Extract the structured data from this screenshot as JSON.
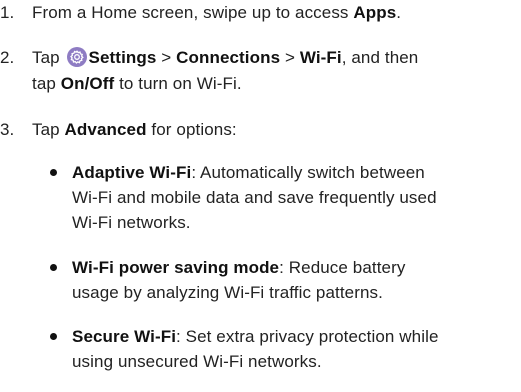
{
  "steps": [
    {
      "number": "1.",
      "segments": [
        {
          "text": "From a Home screen, swipe up to access "
        },
        {
          "text": "Apps",
          "bold": true
        },
        {
          "text": "."
        }
      ]
    },
    {
      "number": "2.",
      "line1": [
        {
          "text": "Tap "
        },
        {
          "text": "Settings",
          "bold": true
        },
        {
          "text": " > "
        },
        {
          "text": "Connections",
          "bold": true
        },
        {
          "text": " > "
        },
        {
          "text": "Wi-Fi",
          "bold": true
        },
        {
          "text": ", and then"
        }
      ],
      "line2": [
        {
          "text": "tap "
        },
        {
          "text": "On/Off",
          "bold": true
        },
        {
          "text": " to turn on Wi-Fi."
        }
      ],
      "icon": "settings-gear-icon"
    },
    {
      "number": "3.",
      "segments": [
        {
          "text": "Tap "
        },
        {
          "text": "Advanced",
          "bold": true
        },
        {
          "text": " for options:"
        }
      ]
    }
  ],
  "options": [
    {
      "name": "Adaptive Wi-Fi",
      "lines": [
        ": Automatically switch between",
        "Wi-Fi and mobile data and save frequently used",
        "Wi-Fi networks."
      ]
    },
    {
      "name": "Wi-Fi power saving mode",
      "lines": [
        ": Reduce battery",
        "usage by analyzing Wi-Fi traffic patterns."
      ]
    },
    {
      "name": "Secure Wi-Fi",
      "lines": [
        ": Set extra privacy protection while",
        "using unsecured Wi-Fi networks."
      ]
    }
  ],
  "colors": {
    "text": "#222222",
    "icon": "#8e7cc3"
  }
}
